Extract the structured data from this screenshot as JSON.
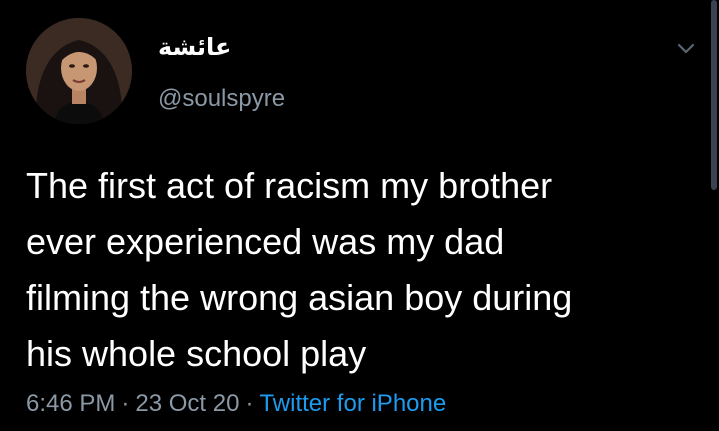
{
  "tweet": {
    "author": {
      "display_name": "عائشة",
      "handle": "@soulspyre"
    },
    "text_lines": [
      "The first act of racism my brother",
      "ever experienced was my dad",
      "filming the wrong asian boy during",
      "his whole school play"
    ],
    "time": "6:46 PM",
    "date": "23 Oct 20",
    "separator": "·",
    "source": "Twitter for iPhone"
  },
  "icons": {
    "caret": "chevron-down-icon"
  },
  "colors": {
    "background": "#000000",
    "text": "#ffffff",
    "secondary": "#8b98a5",
    "link": "#1d9bf0"
  }
}
